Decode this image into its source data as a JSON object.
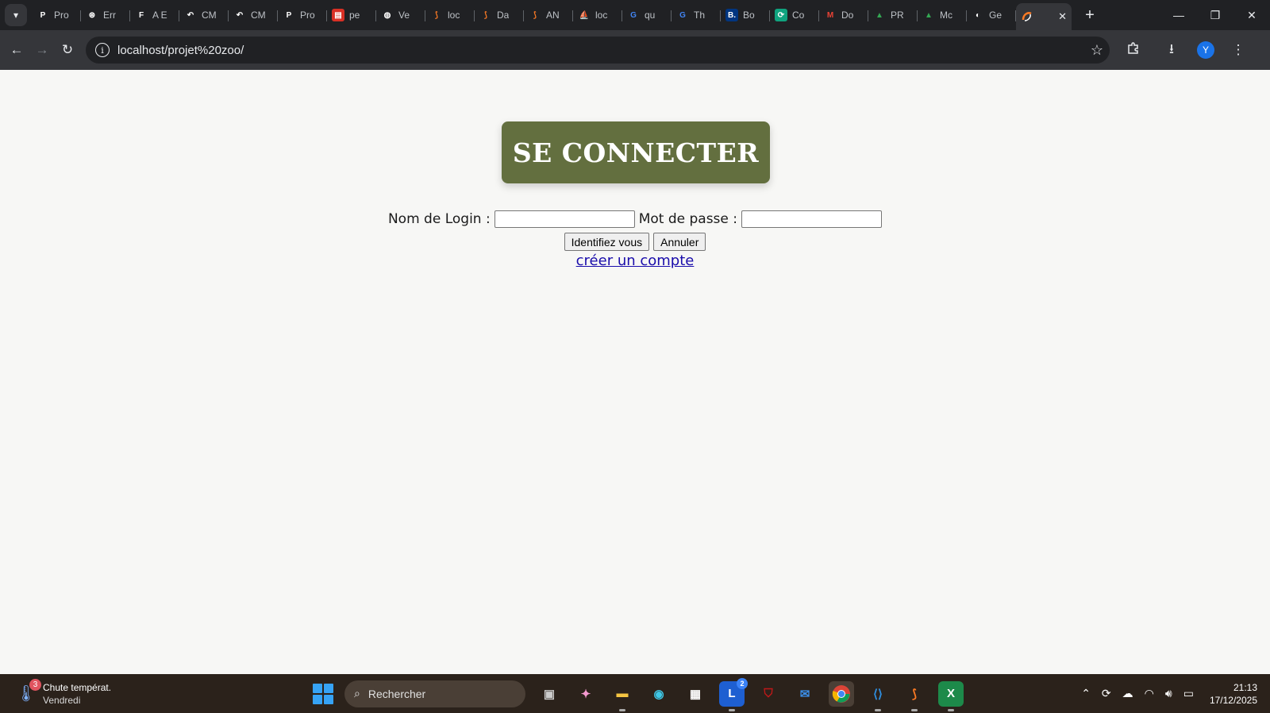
{
  "tabs": [
    {
      "label": "Pro",
      "icon": "p-icon",
      "color": "#202124"
    },
    {
      "label": "Err",
      "icon": "openai-icon",
      "color": "#202124"
    },
    {
      "label": "A E",
      "icon": "f-icon",
      "color": "#202124"
    },
    {
      "label": "CM",
      "icon": "undo-icon",
      "color": "#202124"
    },
    {
      "label": "CM",
      "icon": "undo-icon",
      "color": "#202124"
    },
    {
      "label": "Pro",
      "icon": "p-icon",
      "color": "#202124"
    },
    {
      "label": "pe",
      "icon": "pdf-icon",
      "color": "#d93025"
    },
    {
      "label": "Ve",
      "icon": "globe-icon",
      "color": "#202124"
    },
    {
      "label": "loc",
      "icon": "xampp-icon",
      "color": "#202124"
    },
    {
      "label": "Da",
      "icon": "xampp-icon",
      "color": "#202124"
    },
    {
      "label": "AN",
      "icon": "xampp-icon",
      "color": "#202124"
    },
    {
      "label": "loc",
      "icon": "phpmyadmin-icon",
      "color": "#202124"
    },
    {
      "label": "qu",
      "icon": "google-icon",
      "color": "#202124"
    },
    {
      "label": "Th",
      "icon": "google-icon",
      "color": "#202124"
    },
    {
      "label": "Bo",
      "icon": "booking-icon",
      "color": "#003580"
    },
    {
      "label": "Co",
      "icon": "c-icon",
      "color": "#10a37f"
    },
    {
      "label": "Do",
      "icon": "gmail-icon",
      "color": "#202124"
    },
    {
      "label": "PR",
      "icon": "drive-icon",
      "color": "#202124"
    },
    {
      "label": "Mc",
      "icon": "drive-icon",
      "color": "#202124"
    },
    {
      "label": "Ge",
      "icon": "github-icon",
      "color": "#202124"
    }
  ],
  "active_tab": {
    "icon": "xampp-icon"
  },
  "address_bar": {
    "url": "localhost/projet%20zoo/"
  },
  "profile": {
    "initial": "Y"
  },
  "page": {
    "heading": "SE CONNECTER",
    "login_label": "Nom de Login :",
    "password_label": "Mot de passe :",
    "login_value": "",
    "password_value": "",
    "submit_label": "Identifiez vous",
    "cancel_label": "Annuler",
    "create_account_link": "créer un compte"
  },
  "taskbar": {
    "weather_badge": "3",
    "weather_title": "Chute températ.",
    "weather_subtitle": "Vendredi",
    "search_placeholder": "Rechercher",
    "outlook_badge": "2",
    "time": "21:13",
    "date": "17/12/2025"
  },
  "colors": {
    "heading_bg": "#636f3f",
    "link": "#1a0dab",
    "taskbar_bg": "#2b221b",
    "chrome_dark": "#202124",
    "chrome_toolbar": "#35363a"
  }
}
